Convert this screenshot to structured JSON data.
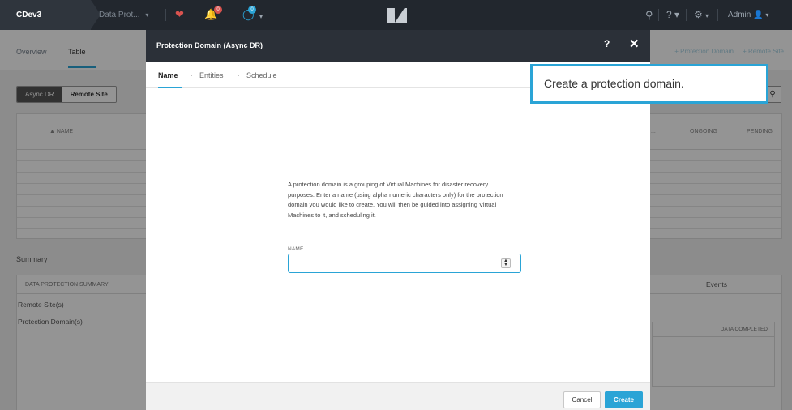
{
  "topbar": {
    "cluster_name": "CDev3",
    "section": "Data Prot...",
    "section_chevron": "▾",
    "health_icon": "heart-icon",
    "alerts_icon": "bell-icon",
    "alerts_count": "0",
    "tasks_icon": "circle-tasks-icon",
    "tasks_count": "0",
    "logo_icon": "nutanix-logo-icon",
    "search_icon": "search-icon",
    "help_label": "?",
    "settings_icon": "gear-icon",
    "user_label": "Admin",
    "colors": {
      "background": "#22272e",
      "alert_badge": "#d9534f",
      "task_badge": "#2aa4d6"
    }
  },
  "page": {
    "tabs": [
      "Overview",
      "Table"
    ],
    "tab_separator": "·",
    "right_actions": [
      "+ Protection Domain",
      "+ Remote Site"
    ],
    "segments": [
      "Async DR",
      "Remote Site"
    ],
    "table_columns": [
      "NAME",
      "...",
      "ONGOING",
      "PENDING"
    ],
    "summary_title": "Summary",
    "summary_header": "DATA PROTECTION SUMMARY",
    "summary_items": [
      "Remote Site(s)",
      "Protection Domain(s)"
    ],
    "events_label": "Events",
    "data_completed_label": "DATA COMPLETED"
  },
  "modal": {
    "title": "Protection Domain (Async DR)",
    "help": "?",
    "close": "✕",
    "tabs": [
      "Name",
      "Entities",
      "Schedule"
    ],
    "tab_separator": "·",
    "description": "A protection domain is a grouping of Virtual Machines for disaster recovery purposes. Enter a name (using alpha numeric characters only) for the protection domain you would like to create. You will then be guided into assigning Virtual Machines to it, and scheduling it.",
    "name_label": "NAME",
    "name_value": "",
    "cancel_label": "Cancel",
    "create_label": "Create",
    "accent": "#2aa4d6"
  },
  "tooltip": {
    "text": "Create a protection domain."
  }
}
